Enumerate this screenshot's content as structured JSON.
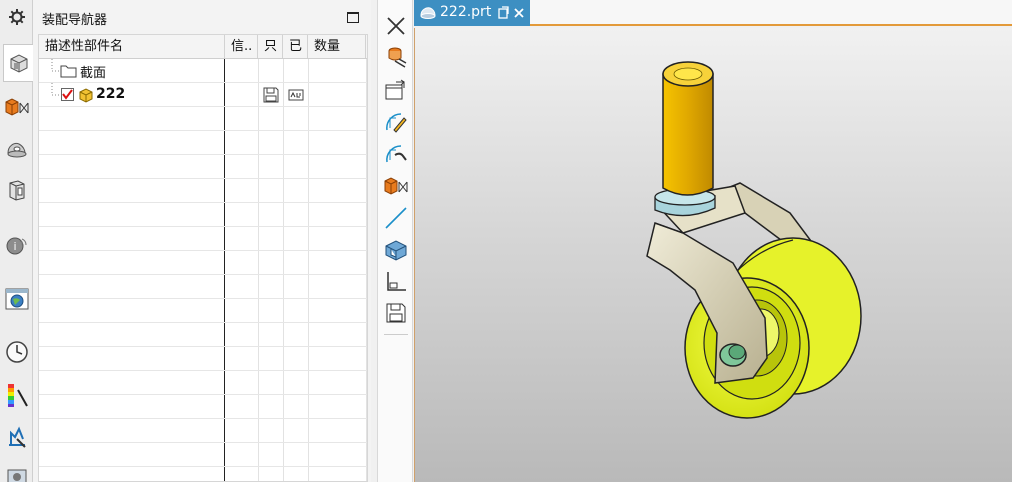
{
  "resource_bar": {
    "items": [
      "settings-icon",
      "assembly-navigator-icon",
      "constraint-navigator-icon",
      "part-navigator-icon",
      "reuse-library-icon",
      "info-icon",
      "web-browser-icon",
      "history-icon",
      "palette-icon",
      "process-studio-icon",
      "roles-icon"
    ]
  },
  "navigator": {
    "title": "装配导航器",
    "columns": [
      "描述性部件名",
      "信..",
      "只",
      "已",
      "数量"
    ],
    "rows": [
      {
        "name": "截面",
        "type": "folder"
      },
      {
        "name": "222",
        "type": "part",
        "checked": true
      }
    ]
  },
  "command_strip": {
    "items": [
      "close-icon",
      "edit-part-icon",
      "open-part-icon",
      "interpart-link-icon",
      "wave-geometry-icon",
      "assembly-constraint-icon",
      "line-icon",
      "add-component-icon",
      "layer-icon",
      "save-icon"
    ]
  },
  "graphics": {
    "tab_label": "222.prt",
    "accent_color": "#3d8fc2",
    "model": "caster-wheel"
  }
}
